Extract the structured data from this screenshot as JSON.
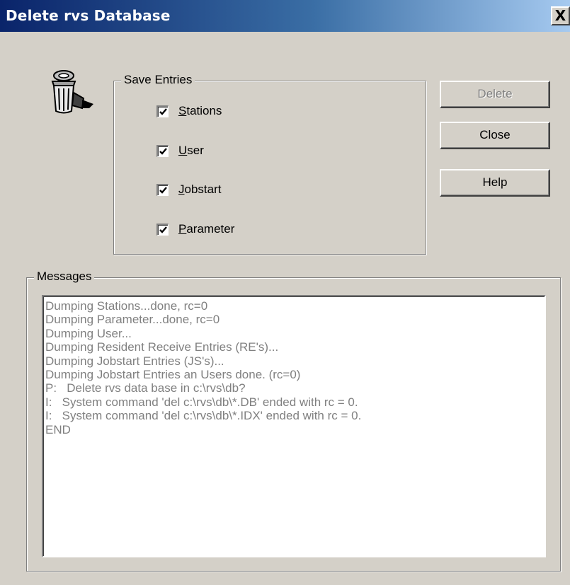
{
  "window": {
    "title": "Delete rvs Database",
    "close_glyph": "X"
  },
  "icon": "trash-can-icon",
  "save_entries": {
    "label": "Save Entries",
    "items": [
      {
        "label": "Stations",
        "checked": true
      },
      {
        "label": "User",
        "checked": true
      },
      {
        "label": "Jobstart",
        "checked": true
      },
      {
        "label": "Parameter",
        "checked": true
      }
    ]
  },
  "buttons": {
    "delete": {
      "label": "Delete",
      "enabled": false
    },
    "close": {
      "label": "Close",
      "enabled": true
    },
    "help": {
      "label": "Help",
      "enabled": true
    }
  },
  "messages": {
    "label": "Messages",
    "lines": [
      "Dumping Stations...done, rc=0",
      "Dumping Parameter...done, rc=0",
      "Dumping User...",
      "Dumping Resident Receive Entries (RE's)...",
      "Dumping Jobstart Entries (JS's)...",
      "Dumping Jobstart Entries an Users done. (rc=0)",
      "P:   Delete rvs data base in c:\\rvs\\db?",
      "I:   System command 'del c:\\rvs\\db\\*.DB' ended with rc = 0.",
      "I:   System command 'del c:\\rvs\\db\\*.IDX' ended with rc = 0.",
      "END"
    ]
  },
  "colors": {
    "title_gradient_start": "#0a246a",
    "title_gradient_end": "#a6caf0",
    "dialog_bg": "#d4d0c8",
    "message_text": "#808080"
  }
}
